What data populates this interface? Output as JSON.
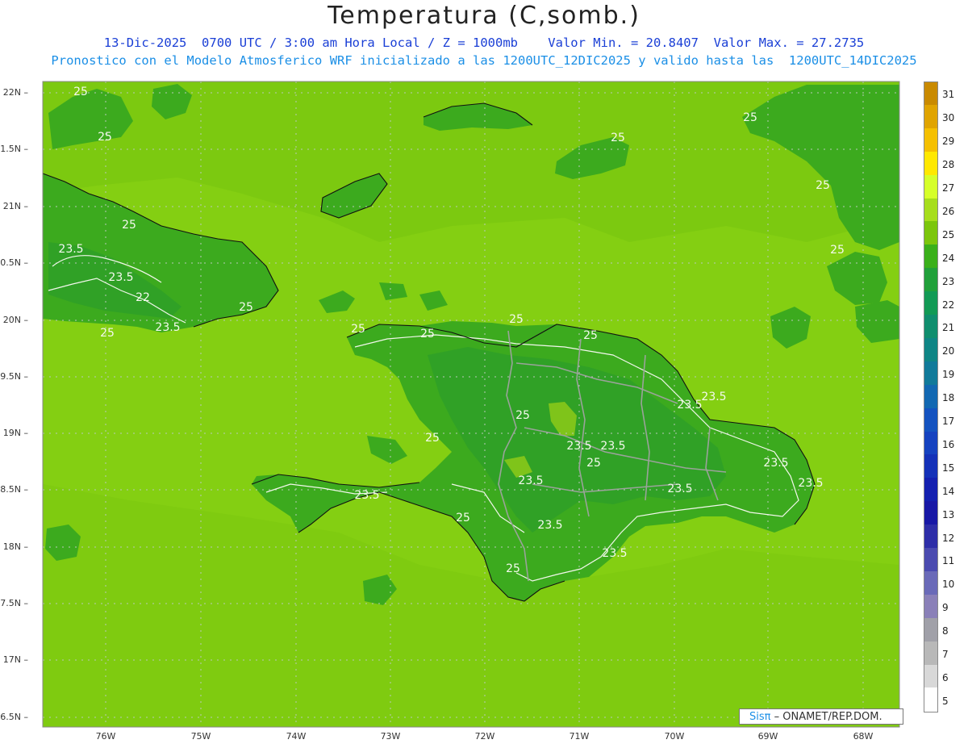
{
  "header": {
    "title": "Temperatura (C,somb.)",
    "line1": "13-Dic-2025  0700 UTC / 3:00 am Hora Local / Z = 1000mb    Valor Min. = 20.8407  Valor Max. = 27.2735",
    "line2": "Pronostico con el Modelo Atmosferico WRF inicializado a las 1200UTC_12DIC2025 y valido hasta las  1200UTC_14DIC2025"
  },
  "axes": {
    "lat_labels": [
      "22N",
      "1.5N",
      "21N",
      "0.5N",
      "20N",
      "9.5N",
      "19N",
      "8.5N",
      "18N",
      "7.5N",
      "17N",
      "6.5N"
    ],
    "lon_labels": [
      "76W",
      "75W",
      "74W",
      "73W",
      "72W",
      "71W",
      "70W",
      "69W",
      "68W"
    ]
  },
  "colorbar": {
    "labels": [
      "31",
      "30",
      "29",
      "28",
      "27",
      "26",
      "25",
      "24",
      "23",
      "22",
      "21",
      "20",
      "19",
      "18",
      "17",
      "16",
      "15",
      "14",
      "13",
      "12",
      "11",
      "10",
      "9",
      "8",
      "7",
      "6",
      "5"
    ],
    "colors": [
      "#c98a00",
      "#e0a400",
      "#f5c000",
      "#ffe800",
      "#d6ff2a",
      "#a7de1c",
      "#7cc60c",
      "#3ab01a",
      "#21a03a",
      "#129a55",
      "#108e6e",
      "#0f8585",
      "#117a9a",
      "#1268b2",
      "#1453c0",
      "#1542c0",
      "#1431b8",
      "#1420b0",
      "#1818a6",
      "#2e2ea8",
      "#4b4bb0",
      "#6a6ab8",
      "#8a80b8",
      "#a0a0a8",
      "#b8b8b8",
      "#d8d8d8",
      "#ffffff"
    ]
  },
  "map": {
    "background_color": "#8ed414",
    "ocean_color": "#84cf12",
    "warm_band_color": "#76c40e",
    "land_color": "#3caa1e",
    "land_core_color": "#2b9c2a",
    "contour_labels": [
      {
        "text": "25"
      },
      {
        "text": "25"
      },
      {
        "text": "25"
      },
      {
        "text": "23.5"
      },
      {
        "text": "23.5"
      },
      {
        "text": "22"
      },
      {
        "text": "25"
      },
      {
        "text": "25"
      },
      {
        "text": "23.5"
      },
      {
        "text": "25"
      },
      {
        "text": "25"
      },
      {
        "text": "25"
      },
      {
        "text": "25"
      },
      {
        "text": "23.5"
      },
      {
        "text": "23.5"
      },
      {
        "text": "25"
      },
      {
        "text": "25"
      },
      {
        "text": "23.5"
      },
      {
        "text": "23.5"
      },
      {
        "text": "25"
      },
      {
        "text": "23.5"
      },
      {
        "text": "23.5"
      },
      {
        "text": "23.5"
      },
      {
        "text": "23.5"
      },
      {
        "text": "23.5"
      },
      {
        "text": "25"
      },
      {
        "text": "23.5"
      },
      {
        "text": "23.5"
      },
      {
        "text": "25"
      },
      {
        "text": "25"
      },
      {
        "text": "25"
      },
      {
        "text": "25"
      },
      {
        "text": "25"
      }
    ]
  },
  "credit": {
    "sis": "Sisπ",
    "rest": " – ONAMET/REP.DOM."
  }
}
